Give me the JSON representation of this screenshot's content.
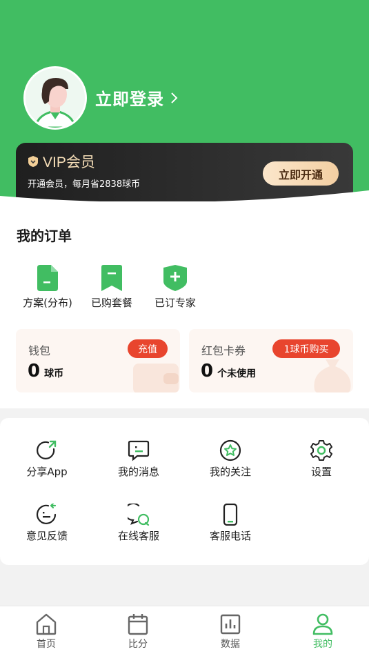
{
  "header": {
    "login_label": "立即登录"
  },
  "vip": {
    "title": "VIP会员",
    "subtitle": "开通会员，每月省2838球币",
    "button_label": "立即开通"
  },
  "orders": {
    "title": "我的订单",
    "items": [
      {
        "label": "方案(分布)",
        "icon": "document-icon"
      },
      {
        "label": "已购套餐",
        "icon": "bookmark-icon"
      },
      {
        "label": "已订专家",
        "icon": "shield-plus-icon"
      }
    ],
    "wallet": {
      "title": "钱包",
      "badge": "充值",
      "value": "0",
      "unit": "球币"
    },
    "coupons": {
      "title": "红包卡券",
      "badge": "1球币购买",
      "value": "0",
      "unit": "个未使用"
    }
  },
  "menu": {
    "items": [
      {
        "label": "分享App",
        "icon": "share-icon"
      },
      {
        "label": "我的消息",
        "icon": "message-icon"
      },
      {
        "label": "我的关注",
        "icon": "star-icon"
      },
      {
        "label": "设置",
        "icon": "gear-icon"
      },
      {
        "label": "意见反馈",
        "icon": "feedback-icon"
      },
      {
        "label": "在线客服",
        "icon": "chat-service-icon"
      },
      {
        "label": "客服电话",
        "icon": "phone-icon"
      }
    ]
  },
  "tabbar": {
    "items": [
      {
        "label": "首页",
        "icon": "home-icon"
      },
      {
        "label": "比分",
        "icon": "calendar-icon"
      },
      {
        "label": "数据",
        "icon": "chart-icon"
      },
      {
        "label": "我的",
        "icon": "user-icon",
        "active": true
      }
    ]
  },
  "colors": {
    "brand_green": "#41bd62",
    "accent_red": "#e8452e",
    "vip_gold": "#f6deb8"
  }
}
